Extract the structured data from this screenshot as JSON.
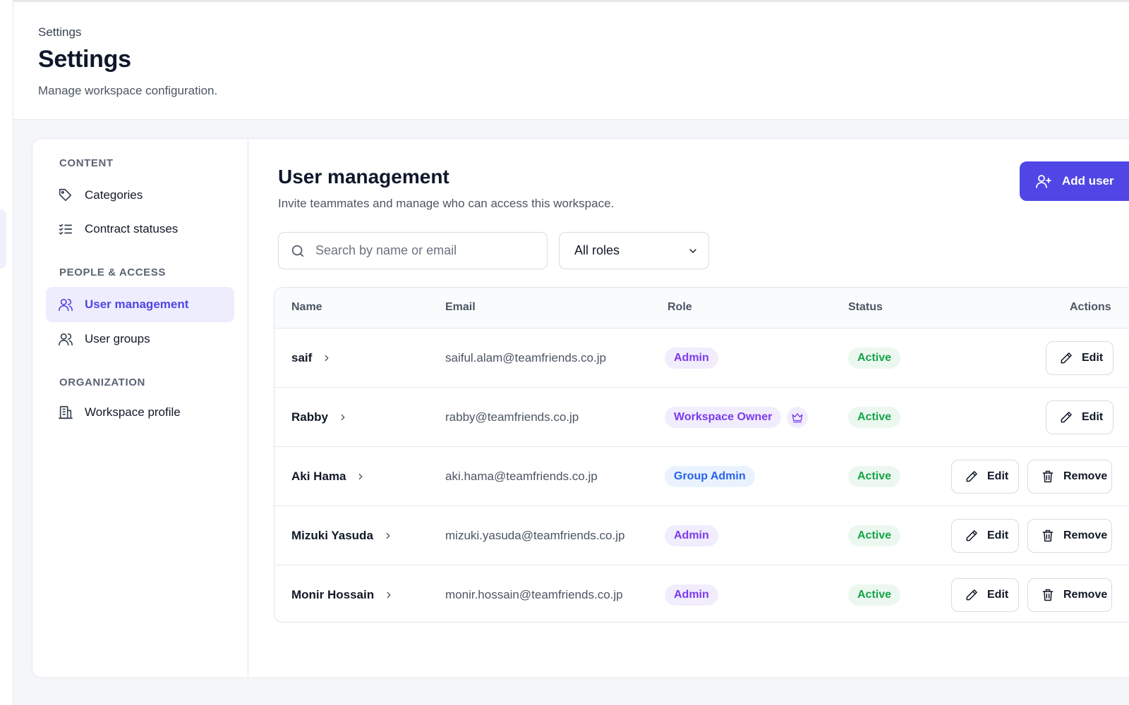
{
  "header": {
    "breadcrumb": "Settings",
    "title": "Settings",
    "subtitle": "Manage workspace configuration."
  },
  "sidebar": {
    "sections": [
      {
        "title": "CONTENT",
        "items": [
          {
            "label": "Categories",
            "icon": "tag-icon",
            "active": false
          },
          {
            "label": "Contract statuses",
            "icon": "checklist-icon",
            "active": false
          }
        ]
      },
      {
        "title": "PEOPLE & ACCESS",
        "items": [
          {
            "label": "User management",
            "icon": "user-icon",
            "active": true
          },
          {
            "label": "User groups",
            "icon": "users-icon",
            "active": false
          }
        ]
      },
      {
        "title": "ORGANIZATION",
        "items": [
          {
            "label": "Workspace profile",
            "icon": "building-icon",
            "active": false
          }
        ]
      }
    ]
  },
  "main": {
    "title": "User management",
    "subtitle": "Invite teammates and manage who can access this workspace.",
    "add_button_label": "Add user",
    "search": {
      "placeholder": "Search by name or email",
      "value": ""
    },
    "role_filter": {
      "selected": "All roles"
    },
    "table": {
      "columns": {
        "name": "Name",
        "email": "Email",
        "role": "Role",
        "status": "Status",
        "actions": "Actions"
      },
      "edit_label": "Edit",
      "remove_label": "Remove",
      "rows": [
        {
          "name": "saif",
          "email": "saiful.alam@teamfriends.co.jp",
          "role": "Admin",
          "status": "Active"
        },
        {
          "name": "Rabby",
          "email": "rabby@teamfriends.co.jp",
          "role": "Workspace Owner",
          "status": "Active"
        },
        {
          "name": "Aki Hama",
          "email": "aki.hama@teamfriends.co.jp",
          "role": "Group Admin",
          "status": "Active"
        },
        {
          "name": "Mizuki Yasuda",
          "email": "mizuki.yasuda@teamfriends.co.jp",
          "role": "Admin",
          "status": "Active"
        },
        {
          "name": "Monir Hossain",
          "email": "monir.hossain@teamfriends.co.jp",
          "role": "Admin",
          "status": "Active"
        }
      ]
    }
  },
  "colors": {
    "accent": "#4f46e5",
    "admin_badge": "#7c3aed",
    "group_admin_badge": "#2563eb",
    "active_status": "#16a34a"
  }
}
